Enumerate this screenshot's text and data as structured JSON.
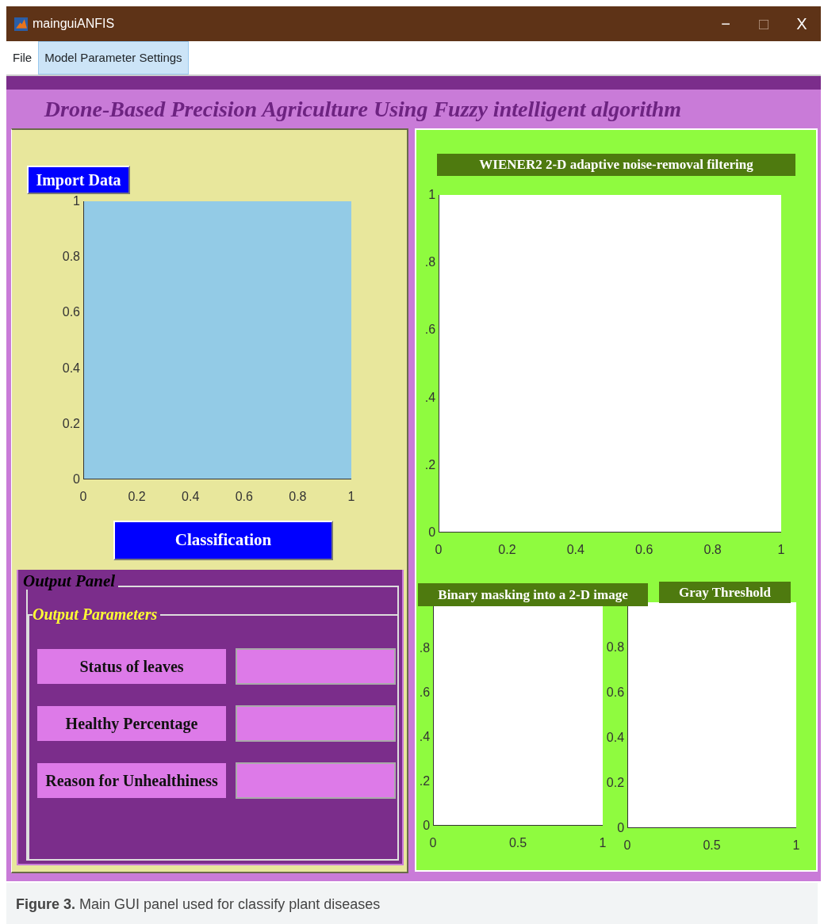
{
  "window": {
    "title": "mainguiANFIS",
    "controls": [
      {
        "label": "−",
        "disabled": false
      },
      {
        "label": "□",
        "disabled": true
      },
      {
        "label": "X",
        "disabled": false
      }
    ]
  },
  "menu": [
    {
      "label": "File",
      "selected": false
    },
    {
      "label": "Model Parameter Settings",
      "selected": true
    }
  ],
  "heading": "Drone-Based Precision Agriculture Using Fuzzy intelligent algorithm",
  "left_panel": {
    "import_button": "Import Data",
    "axes": {
      "y_ticks": [
        "1",
        "0.8",
        "0.6",
        "0.4",
        "0.2",
        "0"
      ],
      "x_ticks": [
        "0",
        "0.2",
        "0.4",
        "0.6",
        "0.8",
        "1"
      ]
    },
    "classify_button": "Classification"
  },
  "output_panel": {
    "title": "Output Panel",
    "group": {
      "title": "Output Parameters",
      "rows": [
        {
          "label": "Status of leaves"
        },
        {
          "label": "Healthy Percentage"
        },
        {
          "label": "Reason for Unhealthiness"
        }
      ]
    }
  },
  "right_panel": {
    "axes": [
      {
        "title": "WIENER2 2-D adaptive noise-removal filtering",
        "y_ticks": [
          "1",
          ".8",
          ".6",
          ".4",
          ".2",
          "0"
        ],
        "x_ticks": [
          "0",
          "0.2",
          "0.4",
          "0.6",
          "0.8",
          "1"
        ]
      },
      {
        "title": "Binary masking into a 2-D image",
        "y_ticks": [
          ".8",
          ".6",
          ".4",
          ".2",
          "0"
        ],
        "x_ticks": [
          "0",
          "0.5",
          "1"
        ]
      },
      {
        "title": "Gray Threshold",
        "y_ticks": [
          "0.8",
          "0.6",
          "0.4",
          "0.2",
          "0"
        ],
        "x_ticks": [
          "0",
          "0.5",
          "1"
        ]
      }
    ]
  },
  "caption": "**Figure 3.** Main GUI panel used for classify plant diseases"
}
